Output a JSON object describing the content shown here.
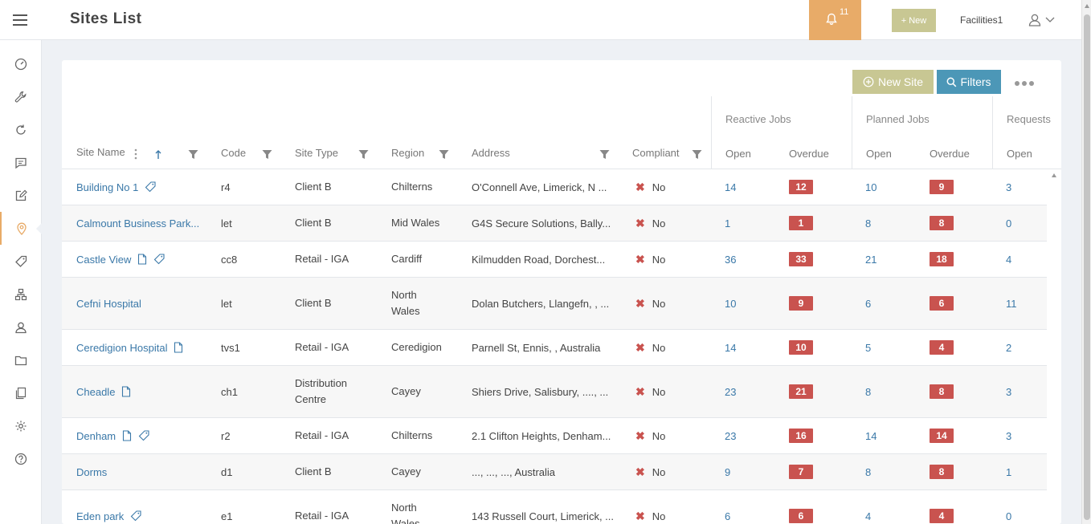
{
  "header": {
    "title": "Sites List",
    "notification_count": "11",
    "new_label": "+ New",
    "user_name": "Facilities1"
  },
  "sidebar": {
    "items": [
      {
        "icon": "dashboard-icon"
      },
      {
        "icon": "wrench-icon"
      },
      {
        "icon": "refresh-icon"
      },
      {
        "icon": "message-icon"
      },
      {
        "icon": "edit-icon"
      },
      {
        "icon": "map-pin-icon",
        "active": true
      },
      {
        "icon": "tag-icon"
      },
      {
        "icon": "hierarchy-icon"
      },
      {
        "icon": "contacts-icon"
      },
      {
        "icon": "folder-icon"
      },
      {
        "icon": "documents-icon"
      },
      {
        "icon": "gear-icon"
      },
      {
        "icon": "help-icon"
      }
    ]
  },
  "toolbar": {
    "new_site_label": "New Site",
    "filters_label": "Filters"
  },
  "table": {
    "group_headers": {
      "reactive": "Reactive Jobs",
      "planned": "Planned Jobs",
      "requests": "Requests"
    },
    "columns": {
      "site_name": "Site Name",
      "code": "Code",
      "site_type": "Site Type",
      "region": "Region",
      "address": "Address",
      "compliant": "Compliant",
      "reactive_open": "Open",
      "reactive_overdue": "Overdue",
      "planned_open": "Open",
      "planned_overdue": "Overdue",
      "requests_open": "Open"
    },
    "rows": [
      {
        "name": "Building No 1",
        "icons": [
          "tag-icon"
        ],
        "code": "r4",
        "type": "Client B",
        "region": "Chilterns",
        "address": "O'Connell Ave, Limerick, N ...",
        "compliant": "No",
        "r_open": "14",
        "r_over": "12",
        "p_open": "10",
        "p_over": "9",
        "req_open": "3"
      },
      {
        "name": "Calmount Business Park...",
        "icons": [],
        "code": "let",
        "type": "Client B",
        "region": "Mid Wales",
        "address": "G4S Secure Solutions, Bally...",
        "compliant": "No",
        "r_open": "1",
        "r_over": "1",
        "p_open": "8",
        "p_over": "8",
        "req_open": "0"
      },
      {
        "name": "Castle View",
        "icons": [
          "document-icon",
          "tag-icon"
        ],
        "code": "cc8",
        "type": "Retail - IGA",
        "region": "Cardiff",
        "address": "Kilmudden Road, Dorchest...",
        "compliant": "No",
        "r_open": "36",
        "r_over": "33",
        "p_open": "21",
        "p_over": "18",
        "req_open": "4"
      },
      {
        "name": "Cefni Hospital",
        "icons": [],
        "code": "let",
        "type": "Client B",
        "region": "North Wales",
        "address": "Dolan Butchers, Llangefn, , ...",
        "compliant": "No",
        "r_open": "10",
        "r_over": "9",
        "p_open": "6",
        "p_over": "6",
        "req_open": "11"
      },
      {
        "name": "Ceredigion Hospital",
        "icons": [
          "document-icon"
        ],
        "code": "tvs1",
        "type": "Retail - IGA",
        "region": "Ceredigion",
        "address": "Parnell St, Ennis, , Australia",
        "compliant": "No",
        "r_open": "14",
        "r_over": "10",
        "p_open": "5",
        "p_over": "4",
        "req_open": "2"
      },
      {
        "name": "Cheadle",
        "icons": [
          "document-icon"
        ],
        "code": "ch1",
        "type": "Distribution Centre",
        "region": "Cayey",
        "address": "Shiers Drive, Salisbury, ...., ...",
        "compliant": "No",
        "r_open": "23",
        "r_over": "21",
        "p_open": "8",
        "p_over": "8",
        "req_open": "3"
      },
      {
        "name": "Denham",
        "icons": [
          "document-icon",
          "tag-icon"
        ],
        "code": "r2",
        "type": "Retail - IGA",
        "region": "Chilterns",
        "address": "2.1 Clifton Heights, Denham...",
        "compliant": "No",
        "r_open": "23",
        "r_over": "16",
        "p_open": "14",
        "p_over": "14",
        "req_open": "3"
      },
      {
        "name": "Dorms",
        "icons": [],
        "code": "d1",
        "type": "Client B",
        "region": "Cayey",
        "address": "..., ..., ..., Australia",
        "compliant": "No",
        "r_open": "9",
        "r_over": "7",
        "p_open": "8",
        "p_over": "8",
        "req_open": "1"
      },
      {
        "name": "Eden park",
        "icons": [
          "tag-icon"
        ],
        "code": "e1",
        "type": "Retail - IGA",
        "region": "North Wales",
        "address": "143 Russell Court, Limerick, ...",
        "compliant": "No",
        "r_open": "6",
        "r_over": "6",
        "p_open": "4",
        "p_over": "4",
        "req_open": "0"
      }
    ]
  },
  "colors": {
    "accent_orange": "#e8ab68",
    "olive_button": "#c8c793",
    "filters_blue": "#4c97b7",
    "overdue_red": "#c9534f",
    "link_blue": "#3a78a8"
  }
}
